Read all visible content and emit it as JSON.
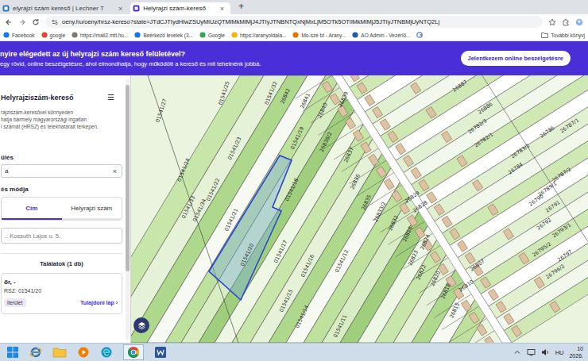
{
  "browser": {
    "tabs": [
      {
        "label": "elyrajzi szám kereső | Lechner T",
        "selected": false,
        "close": "×"
      },
      {
        "label": "Helyrajzi szám-kereső",
        "selected": true,
        "close": "×"
      }
    ],
    "new_tab": "+",
    "url": "oeny.hu/oeny/hrsz-kereso?state=JTdCJTIydHlwZSUyMiUzQTMlMkMlMjJ4JTIyJTNBNTQxNjMxLjM5OTk5OTIlMkMlMjJ5JTIyJTNBMjUyNTQ2Lj",
    "bookmarks": [
      "Facebook",
      "google",
      "https://mail2.mtt.hu...",
      "Beérkező levelek (3...",
      "Google",
      "https://aranyoldala...",
      "Mo-sze bt - Arany...",
      "AO Admin - Vezérlő..."
    ],
    "more_bookmarks": "További könyvj"
  },
  "banner": {
    "title": "nyire elégedett az új helyrajzi szám kereső felületével?",
    "text": "egy rövid, online beszélgetésre, ahol elmondhatja, hogy működött a kereső és mit tehetnénk jobbá.",
    "button": "Jelentkezem online beszélgetésre"
  },
  "sidebar": {
    "title": "Helyrajziszám-kereső",
    "menu": "☰",
    "description": [
      "rajziszám-keresővel könnyeden",
      "hatja bármely magyarországi ingatlan",
      "i számát (HRSZ) és telekhatárait térképen."
    ],
    "settlement_label": "ülés",
    "settlement_value": "a",
    "clear": "×",
    "mode_label": "és módja",
    "tabs": [
      {
        "label": "Cím",
        "selected": true
      },
      {
        "label": "Helyrajzi szám",
        "selected": false
      }
    ],
    "address_placeholder": ".: Kossuth Lajos u. 5.",
    "results_title": "Találatok (1 db)",
    "result": {
      "place": "őr, -",
      "hrsz": "RSZ: 01541/20",
      "type": "lterület",
      "link": "Tulajdoni lap",
      "arrow": "›"
    }
  },
  "map": {
    "labels": [
      "01541/27",
      "01541/25",
      "01541/24",
      "01541/23",
      "01541/22",
      "01541/21",
      "01541/20",
      "01541/33",
      "01541/34",
      "01541/32",
      "01541/19",
      "01541/18",
      "01541/17",
      "01541/16",
      "01541/15",
      "01541/14",
      "01541/12",
      "01541/11",
      "26842",
      "26841",
      "26840",
      "26839",
      "26838/2",
      "26837",
      "26836",
      "26835",
      "26833/2",
      "26832",
      "26829",
      "26828",
      "26826",
      "26824",
      "26823",
      "26822",
      "26820",
      "26818",
      "26815",
      "26887",
      "26886",
      "26782/3",
      "26782/1",
      "26783/2",
      "26786",
      "26787/1",
      "26784",
      "26787/2",
      "26789/1",
      "26790",
      "26791",
      "26792",
      "26793/1",
      "26795/2",
      "26797",
      "26796/2",
      "26807",
      "26810"
    ]
  },
  "taskbar": {
    "language": "HU",
    "time": "10",
    "date": "2026."
  }
}
